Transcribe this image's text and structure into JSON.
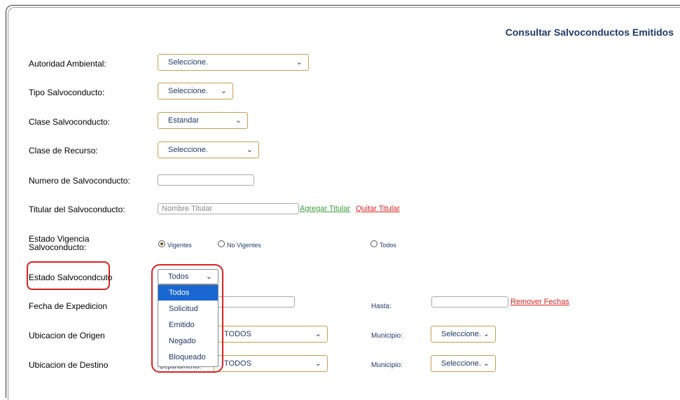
{
  "page_title": "Consultar Salvoconductos Emitidos",
  "fields": {
    "autoridad": {
      "label": "Autoridad Ambiental:",
      "value": "Seleccione."
    },
    "tipo": {
      "label": "Tipo Salvoconducto:",
      "value": "Seleccione."
    },
    "clase": {
      "label": "Clase Salvoconducto:",
      "value": "Estandar"
    },
    "recurso": {
      "label": "Clase de Recurso:",
      "value": "Seleccione."
    },
    "numero": {
      "label": "Numero de Salvoconducto:",
      "value": ""
    },
    "titular": {
      "label": "Titular del Salvoconducto:",
      "placeholder": "Nombre Titular",
      "add_link": "Agregar Titular",
      "remove_link": "Quitar Titular"
    },
    "vigencia": {
      "label_line1": "Estado Vigencia",
      "label_line2": "Salvoconducto:",
      "options": [
        "Vigentes",
        "No Vigentes",
        "Todos"
      ],
      "selected": "Vigentes"
    },
    "estado": {
      "label": "Estado Salvocondcuto",
      "value": "Todos",
      "options": [
        "Todos",
        "Solicitud",
        "Emitido",
        "Negado",
        "Bloqueado"
      ],
      "highlighted": "Todos"
    },
    "fecha": {
      "label": "Fecha de Expedicion",
      "hasta_label": "Hasta:",
      "remove_link": "Remover Fechas"
    },
    "origen": {
      "label": "Ubicacion de Origen",
      "departamento_value": "TODOS",
      "municipio_label": "Municipio:",
      "municipio_value": "Seleccione."
    },
    "destino": {
      "label": "Ubicacion de Destino",
      "departamento_label": "Departamento:",
      "departamento_value": "TODOS",
      "municipio_label": "Municipio:",
      "municipio_value": "Seleccione."
    }
  },
  "icons": {
    "dropdown": "chevron-down-icon"
  },
  "colors": {
    "title": "#1f3a68",
    "select_border": "#c7a04c",
    "highlight": "#e02020",
    "selected_option": "#1967d2",
    "link_green": "#3c9d3c"
  }
}
